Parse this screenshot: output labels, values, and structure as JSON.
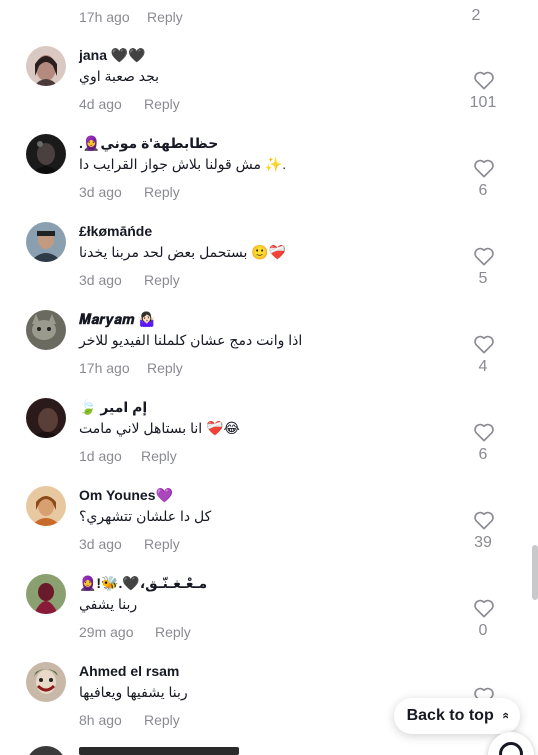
{
  "top_partial": {
    "time": "17h ago",
    "reply_label": "Reply",
    "like_count": "2"
  },
  "comments": [
    {
      "username": "jana 🖤🖤",
      "text": "بجد صعبة اوي",
      "time": "4d ago",
      "reply_label": "Reply",
      "like_count": "101",
      "avatar_color": "#b48a7e"
    },
    {
      "username": ".🧕حظابطهة'ة موني",
      "text": "مش قولنا بلاش جواز القرايب دا ✨.",
      "time": "3d ago",
      "reply_label": "Reply",
      "like_count": "6",
      "avatar_color": "#2a2a2a"
    },
    {
      "username": "£łkømāńde",
      "text": "بستحمل بعض لحد مربنا يخدنا 🙂❤️‍🩹",
      "time": "3d ago",
      "reply_label": "Reply",
      "like_count": "5",
      "avatar_color": "#6c7e8a"
    },
    {
      "username": "𝑴𝒂𝒓𝒚𝒂𝒎 🤷🏻‍♀️",
      "text": "اذا وانت دمج عشان كلملنا الفيديو للاخر",
      "time": "17h ago",
      "reply_label": "Reply",
      "like_count": "4",
      "avatar_color": "#5a5a52"
    },
    {
      "username": "🍃 إم امير",
      "text": "انا بستاهل لاني مامت ❤️‍🩹😂",
      "time": "1d ago",
      "reply_label": "Reply",
      "like_count": "6",
      "avatar_color": "#3c2a28"
    },
    {
      "username": "Om Younes💜",
      "text": "كل دا علشان تتشهري؟",
      "time": "3d ago",
      "reply_label": "Reply",
      "like_count": "39",
      "avatar_color": "#c08a5a"
    },
    {
      "username": "🧕!🐝.🖤،مـعْـغـنّـق",
      "text": "ربنا يشفي",
      "time": "29m ago",
      "reply_label": "Reply",
      "like_count": "0",
      "avatar_color": "#7a3a4a"
    },
    {
      "username": "Ahmed el rsam",
      "text": "ربنا يشفيها ويعافيها",
      "time": "8h ago",
      "reply_label": "Reply",
      "like_count": "",
      "avatar_color": "#8a5a4a"
    }
  ],
  "back_to_top": {
    "label": "Back to top"
  },
  "icons": {
    "heart": "heart-outline-icon",
    "chevron": "double-chevron-up-icon"
  },
  "colors": {
    "text_primary": "#161823",
    "text_secondary": "#8a8b91",
    "background": "#ffffff"
  }
}
